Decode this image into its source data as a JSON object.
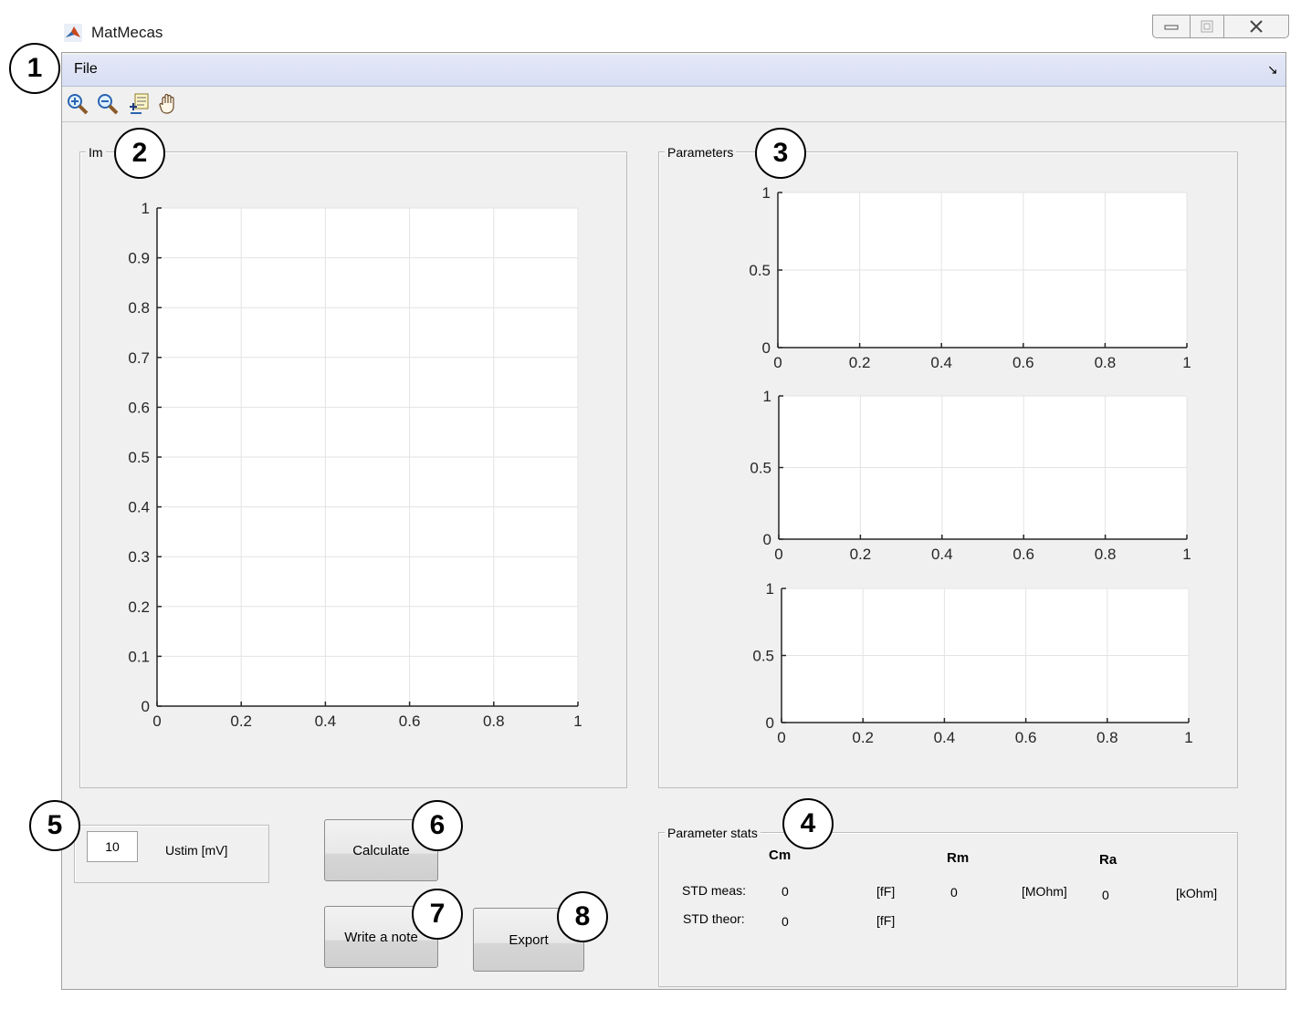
{
  "window": {
    "title": "MatMecas"
  },
  "menu": {
    "file": "File",
    "arrow": "↘"
  },
  "toolbar": {
    "icons": [
      "zoom-in-icon",
      "zoom-out-icon",
      "data-cursor-icon",
      "pan-hand-icon"
    ]
  },
  "panels": {
    "im": "Im",
    "parameters": "Parameters",
    "stats": "Parameter stats"
  },
  "ustim": {
    "value": "10",
    "label": "Ustim [mV]"
  },
  "buttons": {
    "calculate": "Calculate",
    "note": "Write a note",
    "export": "Export"
  },
  "stats": {
    "headers": {
      "cm": "Cm",
      "rm": "Rm",
      "ra": "Ra"
    },
    "std_meas": {
      "label": "STD meas:",
      "cm": "0",
      "cm_unit": "[fF]",
      "rm": "0",
      "rm_unit": "[MOhm]",
      "ra": "0",
      "ra_unit": "[kOhm]"
    },
    "std_theor": {
      "label": "STD theor:",
      "cm": "0",
      "cm_unit": "[fF]"
    }
  },
  "callouts": [
    "1",
    "2",
    "3",
    "4",
    "5",
    "6",
    "7",
    "8"
  ],
  "colors": {
    "menubar": "#dbe1f4",
    "window": "#f0f0f0",
    "grid": "#e3e3e3"
  },
  "chart_data": [
    {
      "type": "line",
      "series": [],
      "xlim": [
        0,
        1
      ],
      "ylim": [
        0,
        1
      ],
      "xticks": [
        "0",
        "0.2",
        "0.4",
        "0.6",
        "0.8",
        "1"
      ],
      "yticks": [
        "0",
        "0.1",
        "0.2",
        "0.3",
        "0.4",
        "0.5",
        "0.6",
        "0.7",
        "0.8",
        "0.9",
        "1"
      ],
      "grid": true
    },
    {
      "type": "line",
      "series": [],
      "xlim": [
        0,
        1
      ],
      "ylim": [
        0,
        1
      ],
      "xticks": [
        "0",
        "0.2",
        "0.4",
        "0.6",
        "0.8",
        "1"
      ],
      "yticks": [
        "0",
        "0.5",
        "1"
      ],
      "grid": true
    },
    {
      "type": "line",
      "series": [],
      "xlim": [
        0,
        1
      ],
      "ylim": [
        0,
        1
      ],
      "xticks": [
        "0",
        "0.2",
        "0.4",
        "0.6",
        "0.8",
        "1"
      ],
      "yticks": [
        "0",
        "0.5",
        "1"
      ],
      "grid": true
    },
    {
      "type": "line",
      "series": [],
      "xlim": [
        0,
        1
      ],
      "ylim": [
        0,
        1
      ],
      "xticks": [
        "0",
        "0.2",
        "0.4",
        "0.6",
        "0.8",
        "1"
      ],
      "yticks": [
        "0",
        "0.5",
        "1"
      ],
      "grid": true
    }
  ]
}
